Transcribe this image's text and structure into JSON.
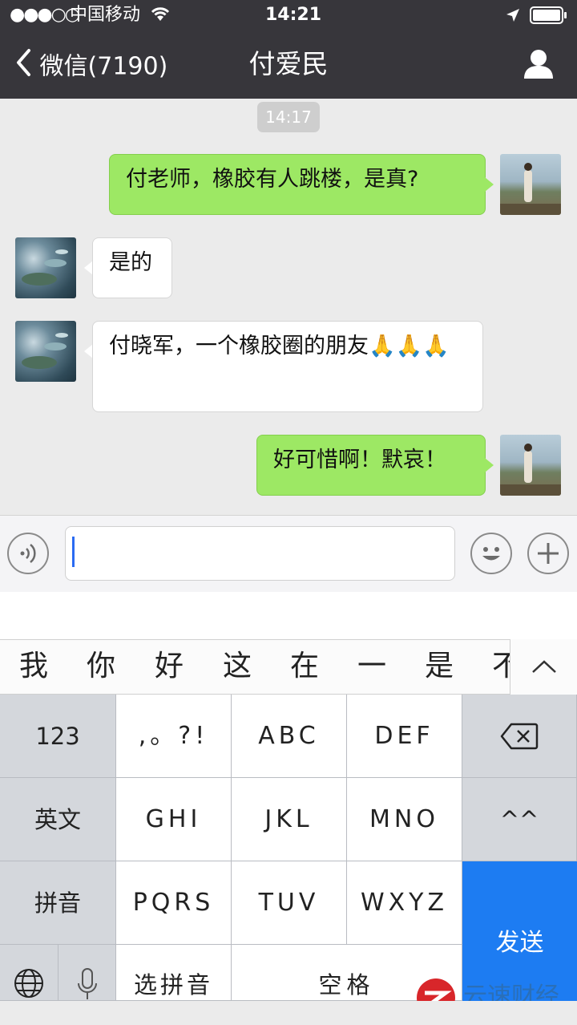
{
  "status_bar": {
    "signal": "●●●○○",
    "carrier": "中国移动",
    "time": "14:21"
  },
  "nav": {
    "back_label": "微信(7190)",
    "title": "付爱民"
  },
  "chat": {
    "timestamp": "14:17",
    "messages": [
      {
        "from": "me",
        "text": "付老师，橡胶有人跳楼，是真?"
      },
      {
        "from": "other",
        "text": "是的"
      },
      {
        "from": "other",
        "text": "付晓军，一个橡胶圈的朋友🙏🙏🙏"
      },
      {
        "from": "me",
        "text": "好可惜啊！默哀！"
      }
    ]
  },
  "input": {
    "value": ""
  },
  "candidates": [
    "我",
    "你",
    "好",
    "这",
    "在",
    "一",
    "是",
    "不"
  ],
  "keyboard": {
    "row1": [
      "123",
      ",。?!",
      "ABC",
      "DEF"
    ],
    "row2": [
      "英文",
      "GHI",
      "JKL",
      "MNO",
      "^^"
    ],
    "row3": [
      "拼音",
      "PQRS",
      "TUV",
      "WXYZ"
    ],
    "row4": [
      "选拼音",
      "空格"
    ],
    "send": "发送"
  },
  "watermark": "云速财经",
  "colors": {
    "sent_bubble": "#9de864",
    "received_bubble": "#ffffff",
    "nav_bar": "#37363b",
    "send_key": "#1d7cf2"
  }
}
